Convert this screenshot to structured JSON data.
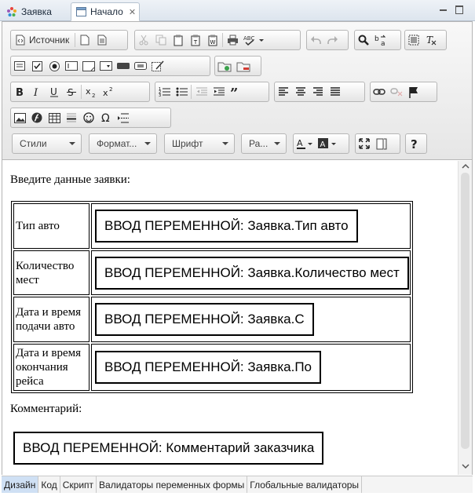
{
  "tabs": {
    "inactive_label": "Заявка",
    "active_label": "Начало"
  },
  "toolbar": {
    "source_label": "Источник",
    "combos": {
      "styles": "Стили",
      "format": "Формат...",
      "font": "Шрифт",
      "size": "Ра..."
    }
  },
  "content": {
    "intro": "Введите данные заявки:",
    "rows": [
      {
        "label": "Тип авто",
        "variable": "ВВОД ПЕРЕМЕННОЙ: Заявка.Тип авто"
      },
      {
        "label": "Количество мест",
        "variable": "ВВОД ПЕРЕМЕННОЙ: Заявка.Количество мест"
      },
      {
        "label": "Дата и время подачи авто",
        "variable": "ВВОД ПЕРЕМЕННОЙ: Заявка.С"
      },
      {
        "label": "Дата и время окончания рейса",
        "variable": "ВВОД ПЕРЕМЕННОЙ: Заявка.По"
      }
    ],
    "comment_label": "Комментарий:",
    "comment_variable": "ВВОД ПЕРЕМЕННОЙ: Комментарий заказчика"
  },
  "bottom_tabs": [
    "Дизайн",
    "Код",
    "Скрипт",
    "Валидаторы переменных формы",
    "Глобальные валидаторы"
  ],
  "icons": {
    "tab_inactive": "flower-icon",
    "tab_active": "window-icon",
    "accent": "#3d78c2"
  }
}
